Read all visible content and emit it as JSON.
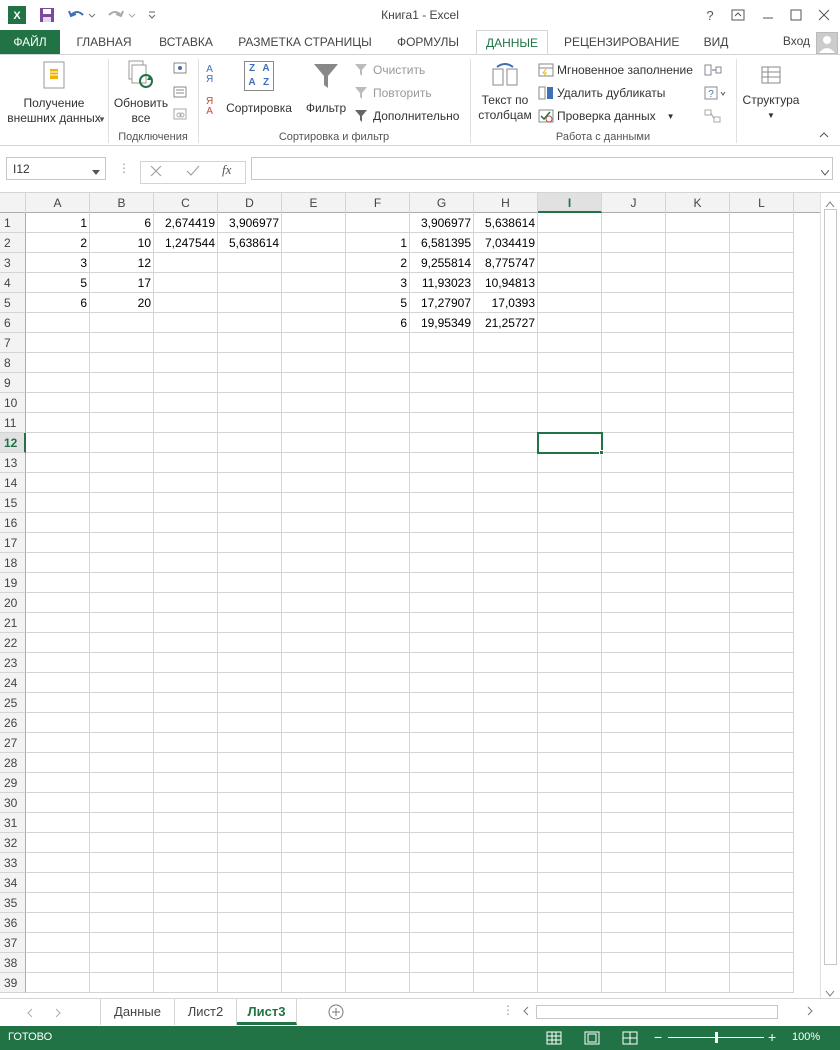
{
  "window": {
    "title": "Книга1 - Excel",
    "help": "?",
    "sign_in": "Вход"
  },
  "tabs": [
    "ФАЙЛ",
    "ГЛАВНАЯ",
    "ВСТАВКА",
    "РАЗМЕТКА СТРАНИЦЫ",
    "ФОРМУЛЫ",
    "ДАННЫЕ",
    "РЕЦЕНЗИРОВАНИЕ",
    "ВИД"
  ],
  "ribbon": {
    "get_external": {
      "line1": "Получение",
      "line2": "внешних данных"
    },
    "refresh": {
      "line1": "Обновить",
      "line2": "все"
    },
    "group_connections": "Подключения",
    "sort": "Сортировка",
    "sort_az_top": "А",
    "sort_az_bottom": "Я",
    "sort_icon_z": "Z",
    "sort_icon_a": "A",
    "filter": "Фильтр",
    "clear": "Очистить",
    "reapply": "Повторить",
    "advanced": "Дополнительно",
    "group_sort_filter": "Сортировка и фильтр",
    "text_to_columns": {
      "line1": "Текст по",
      "line2": "столбцам"
    },
    "flash_fill": "Мгновенное заполнение",
    "remove_duplicates": "Удалить дубликаты",
    "data_validation": "Проверка данных",
    "group_data_tools": "Работа с данными",
    "outline": "Структура"
  },
  "formula_bar": {
    "name_box": "I12",
    "fx": "fx",
    "formula": ""
  },
  "grid": {
    "columns": [
      "A",
      "B",
      "C",
      "D",
      "E",
      "F",
      "G",
      "H",
      "I",
      "J",
      "K",
      "L"
    ],
    "selected_column": "I",
    "selected_row": "12",
    "rows": [
      "1",
      "2",
      "3",
      "4",
      "5",
      "6",
      "7",
      "8",
      "9",
      "10",
      "11",
      "12",
      "13",
      "14",
      "15",
      "16",
      "17",
      "18",
      "19",
      "20",
      "21",
      "22",
      "23",
      "24",
      "25",
      "26",
      "27",
      "28",
      "29",
      "30",
      "31",
      "32",
      "33",
      "34",
      "35",
      "36",
      "37",
      "38",
      "39"
    ],
    "cells": {
      "A1": "1",
      "B1": "6",
      "C1": "2,674419",
      "D1": "3,906977",
      "G1": "3,906977",
      "H1": "5,638614",
      "A2": "2",
      "B2": "10",
      "C2": "1,247544",
      "D2": "5,638614",
      "F2": "1",
      "G2": "6,581395",
      "H2": "7,034419",
      "A3": "3",
      "B3": "12",
      "F3": "2",
      "G3": "9,255814",
      "H3": "8,775747",
      "A4": "5",
      "B4": "17",
      "F4": "3",
      "G4": "11,93023",
      "H4": "10,94813",
      "A5": "6",
      "B5": "20",
      "F5": "5",
      "G5": "17,27907",
      "H5": "17,0393",
      "F6": "6",
      "G6": "19,95349",
      "H6": "21,25727"
    }
  },
  "sheets": [
    "Данные",
    "Лист2",
    "Лист3"
  ],
  "active_sheet": "Лист3",
  "status": {
    "text": "ГОТОВО",
    "zoom": "100%",
    "zoom_fraction": 0.5
  },
  "colors": {
    "accent": "#217346",
    "ribbon_bg": "#ffffff",
    "header_bg": "#f3f3f3"
  }
}
